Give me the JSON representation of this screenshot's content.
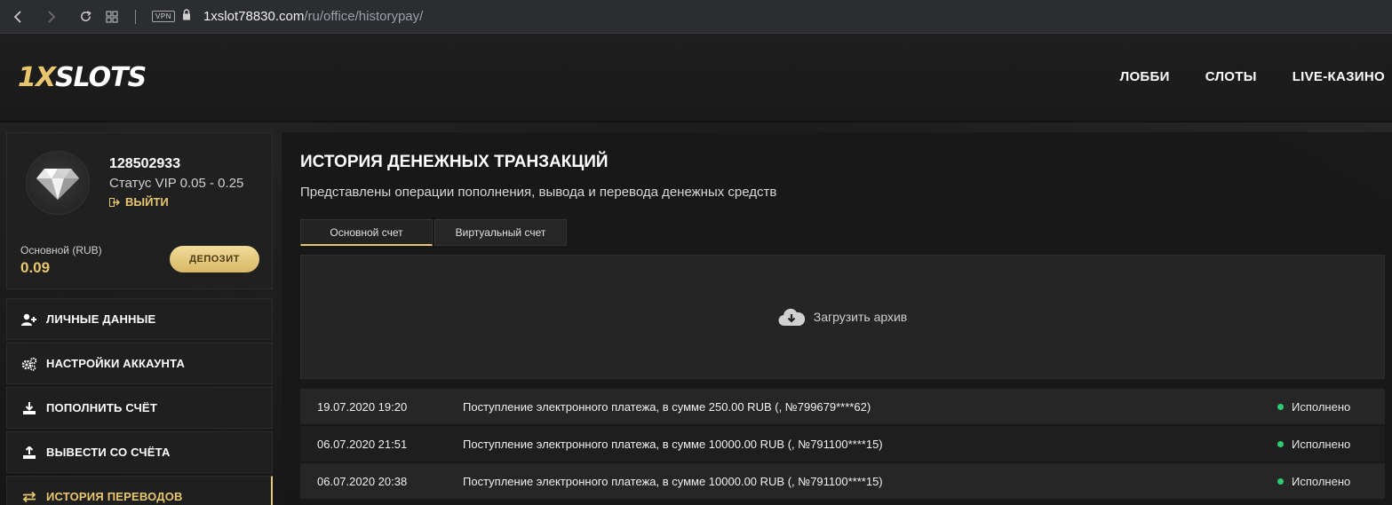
{
  "browser": {
    "vpn_label": "VPN",
    "url_host": "1xslot78830.com",
    "url_path": "/ru/office/historypay/"
  },
  "header": {
    "logo_prefix": "1X",
    "logo_suffix": "SLOTS",
    "nav": [
      "ЛОББИ",
      "СЛОТЫ",
      "LIVE-КАЗИНО"
    ]
  },
  "profile": {
    "user_id": "128502933",
    "vip_status": "Статус VIP 0.05 - 0.25",
    "logout_label": "ВЫЙТИ",
    "balance_label": "Основной (RUB)",
    "balance_value": "0.09",
    "deposit_label": "ДЕПОЗИТ"
  },
  "sidebar": {
    "items": [
      {
        "label": "ЛИЧНЫЕ ДАННЫЕ",
        "icon": "user-plus-icon"
      },
      {
        "label": "НАСТРОЙКИ АККАУНТА",
        "icon": "gears-icon"
      },
      {
        "label": "ПОПОЛНИТЬ СЧЁТ",
        "icon": "download-tray-icon"
      },
      {
        "label": "ВЫВЕСТИ СО СЧЁТА",
        "icon": "upload-tray-icon"
      },
      {
        "label": "ИСТОРИЯ ПЕРЕВОДОВ",
        "icon": "transfer-arrows-icon"
      }
    ]
  },
  "main": {
    "title": "ИСТОРИЯ ДЕНЕЖНЫХ ТРАНЗАКЦИЙ",
    "subtitle": "Представлены операции пополнения, вывода и перевода денежных средств",
    "tabs": [
      "Основной счет",
      "Виртуальный счет"
    ],
    "archive_label": "Загрузить архив",
    "transactions": [
      {
        "date": "19.07.2020 19:20",
        "description": "Поступление электронного платежа, в сумме 250.00 RUB (, №799679****62)",
        "status": "Исполнено"
      },
      {
        "date": "06.07.2020 21:51",
        "description": "Поступление электронного платежа, в сумме 10000.00 RUB (, №791100****15)",
        "status": "Исполнено"
      },
      {
        "date": "06.07.2020 20:38",
        "description": "Поступление электронного платежа, в сумме 10000.00 RUB (, №791100****15)",
        "status": "Исполнено"
      }
    ]
  },
  "colors": {
    "accent": "#e7c66e",
    "status_ok": "#2ecc71"
  }
}
